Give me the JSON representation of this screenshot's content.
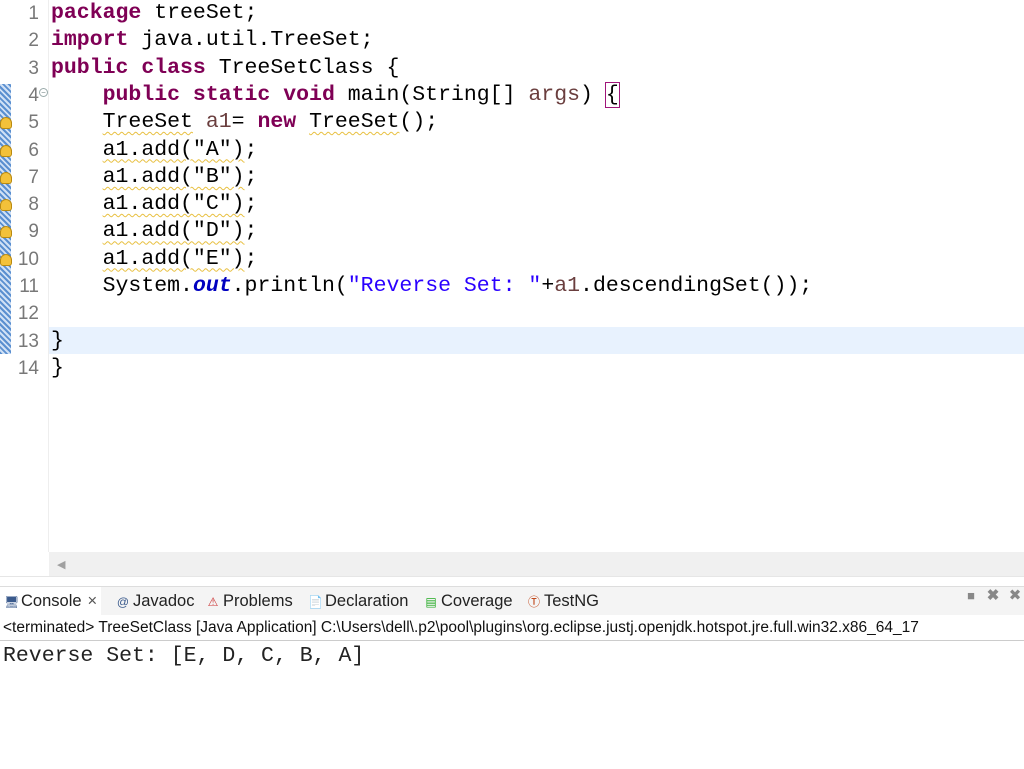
{
  "editor": {
    "line_numbers": [
      "1",
      "2",
      "3",
      "4",
      "5",
      "6",
      "7",
      "8",
      "9",
      "10",
      "11",
      "12",
      "13",
      "14"
    ],
    "lines": [
      [
        {
          "t": "package",
          "c": "kw"
        },
        {
          "t": " treeSet;"
        }
      ],
      [
        {
          "t": "import",
          "c": "kw"
        },
        {
          "t": " java.util.TreeSet;"
        }
      ],
      [
        {
          "t": "public class",
          "c": "kw"
        },
        {
          "t": " TreeSetClass {"
        }
      ],
      [
        {
          "t": "    "
        },
        {
          "t": "public static void",
          "c": "kw"
        },
        {
          "t": " main(String[] "
        },
        {
          "t": "args",
          "c": "var"
        },
        {
          "t": ") "
        },
        {
          "t": "{",
          "c": "bracket"
        }
      ],
      [
        {
          "t": "    "
        },
        {
          "t": "TreeSet",
          "c": "sq"
        },
        {
          "t": " "
        },
        {
          "t": "a1",
          "c": "var"
        },
        {
          "t": "= "
        },
        {
          "t": "new",
          "c": "kw"
        },
        {
          "t": " "
        },
        {
          "t": "TreeSet",
          "c": "sq"
        },
        {
          "t": "();"
        }
      ],
      [
        {
          "t": "    "
        },
        {
          "t": "a1.add(\"A\")",
          "c": "sq"
        },
        {
          "t": ";"
        }
      ],
      [
        {
          "t": "    "
        },
        {
          "t": "a1.add(\"B\")",
          "c": "sq"
        },
        {
          "t": ";"
        }
      ],
      [
        {
          "t": "    "
        },
        {
          "t": "a1.add(\"C\")",
          "c": "sq"
        },
        {
          "t": ";"
        }
      ],
      [
        {
          "t": "    "
        },
        {
          "t": "a1.add(\"D\")",
          "c": "sq"
        },
        {
          "t": ";"
        }
      ],
      [
        {
          "t": "    "
        },
        {
          "t": "a1.add(\"E\")",
          "c": "sq"
        },
        {
          "t": ";"
        }
      ],
      [
        {
          "t": "    System."
        },
        {
          "t": "out",
          "c": "fld"
        },
        {
          "t": ".println("
        },
        {
          "t": "\"Reverse Set: \"",
          "c": "str"
        },
        {
          "t": "+"
        },
        {
          "t": "a1",
          "c": "var"
        },
        {
          "t": ".descendingSet());"
        }
      ],
      [],
      [
        {
          "t": "}"
        }
      ],
      [
        {
          "t": "}"
        }
      ]
    ],
    "warning_lines": [
      5,
      6,
      7,
      8,
      9,
      10
    ],
    "current_line": 13
  },
  "console": {
    "tabs": [
      {
        "label": "Console",
        "icon": "console-icon",
        "active": true,
        "close": "×"
      },
      {
        "label": "Javadoc",
        "icon": "at-icon"
      },
      {
        "label": "Problems",
        "icon": "problems-icon"
      },
      {
        "label": "Declaration",
        "icon": "declaration-icon"
      },
      {
        "label": "Coverage",
        "icon": "coverage-icon"
      },
      {
        "label": "TestNG",
        "icon": "testng-icon"
      }
    ],
    "status": "<terminated> TreeSetClass [Java Application] C:\\Users\\dell\\.p2\\pool\\plugins\\org.eclipse.justj.openjdk.hotspot.jre.full.win32.x86_64_17",
    "output": "Reverse Set: [E, D, C, B, A]"
  }
}
